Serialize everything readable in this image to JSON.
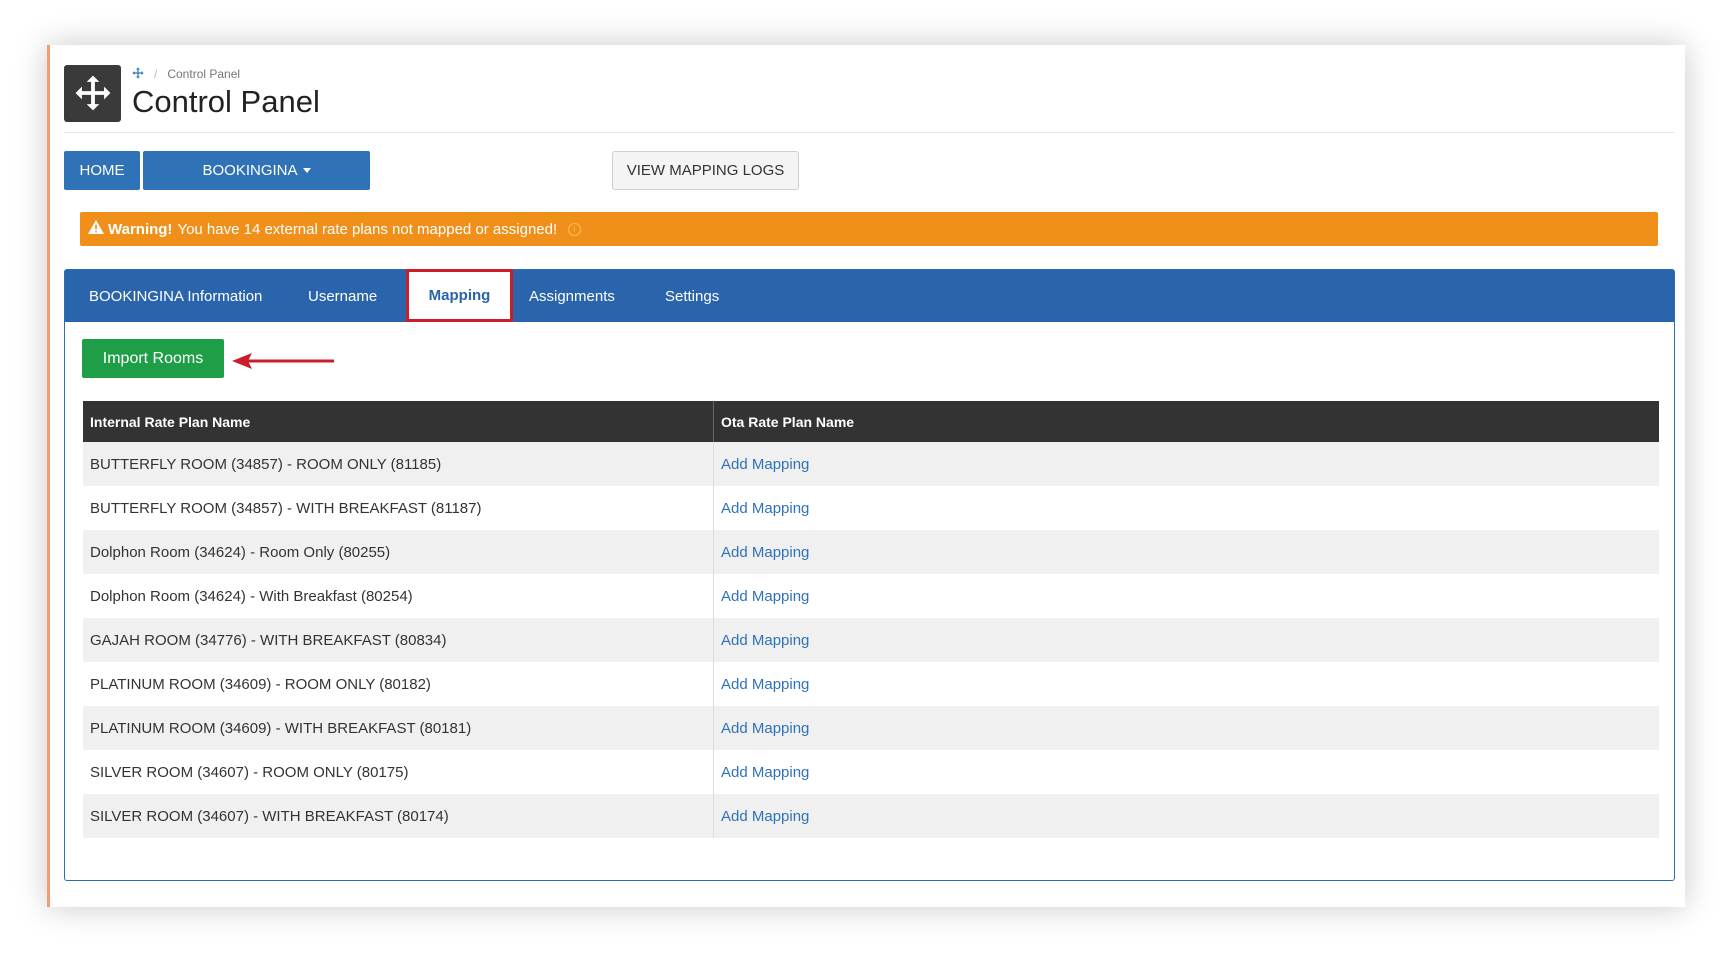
{
  "breadcrumb": {
    "icon": "move-icon",
    "current": "Control Panel"
  },
  "page_title": "Control Panel",
  "nav": {
    "home_label": "HOME",
    "bookingina_label": "BOOKINGINA",
    "view_logs_label": "VIEW MAPPING LOGS"
  },
  "warning": {
    "title": "Warning!",
    "message": "You have 14 external rate plans not mapped or assigned!"
  },
  "tabs": [
    {
      "label": "BOOKINGINA Information"
    },
    {
      "label": "Username"
    },
    {
      "label": "Mapping"
    },
    {
      "label": "Assignments"
    },
    {
      "label": "Settings"
    }
  ],
  "active_tab": "Mapping",
  "import_button_label": "Import Rooms",
  "table": {
    "headers": [
      "Internal Rate Plan Name",
      "Ota Rate Plan Name"
    ],
    "rows": [
      {
        "internal": "BUTTERFLY ROOM (34857) - ROOM ONLY (81185)",
        "action": "Add Mapping"
      },
      {
        "internal": "BUTTERFLY ROOM (34857) - WITH BREAKFAST (81187)",
        "action": "Add Mapping"
      },
      {
        "internal": "Dolphon Room (34624) - Room Only (80255)",
        "action": "Add Mapping"
      },
      {
        "internal": "Dolphon Room (34624) - With Breakfast (80254)",
        "action": "Add Mapping"
      },
      {
        "internal": "GAJAH ROOM (34776) - WITH BREAKFAST (80834)",
        "action": "Add Mapping"
      },
      {
        "internal": "PLATINUM ROOM (34609) - ROOM ONLY (80182)",
        "action": "Add Mapping"
      },
      {
        "internal": "PLATINUM ROOM (34609) - WITH BREAKFAST (80181)",
        "action": "Add Mapping"
      },
      {
        "internal": "SILVER ROOM (34607) - ROOM ONLY (80175)",
        "action": "Add Mapping"
      },
      {
        "internal": "SILVER ROOM (34607) - WITH BREAKFAST (80174)",
        "action": "Add Mapping"
      }
    ]
  },
  "colors": {
    "primary": "#2f72b8",
    "tabbar": "#2a64ad",
    "warning": "#f0901a",
    "success": "#1f9e48",
    "highlight": "#cc1e2a",
    "table_header": "#333333"
  }
}
